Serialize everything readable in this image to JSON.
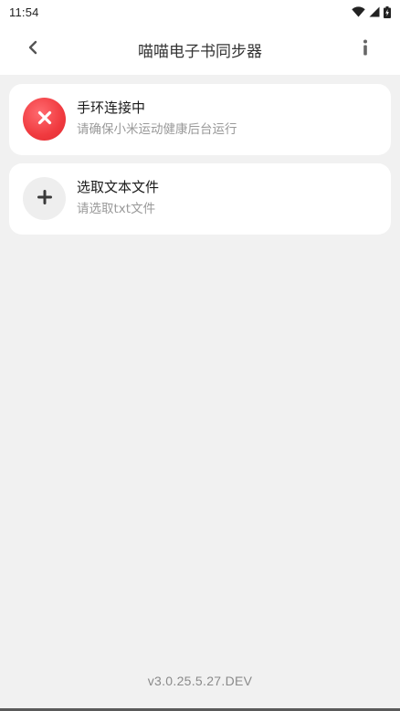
{
  "status_bar": {
    "time": "11:54",
    "icons": [
      "wifi-icon",
      "cell-signal-icon",
      "battery-charging-icon"
    ]
  },
  "app_bar": {
    "title": "喵喵电子书同步器",
    "back_icon": "chevron-left-icon",
    "info_icon": "info-icon"
  },
  "cards": [
    {
      "title": "手环连接中",
      "subtitle": "请确保小米运动健康后台运行",
      "icon": "close-icon",
      "icon_color": "#f03a3f"
    },
    {
      "title": "选取文本文件",
      "subtitle": "请选取txt文件",
      "icon": "plus-icon",
      "icon_color": "#3a3a3a"
    }
  ],
  "footer": {
    "version": "v3.0.25.5.27.DEV"
  }
}
